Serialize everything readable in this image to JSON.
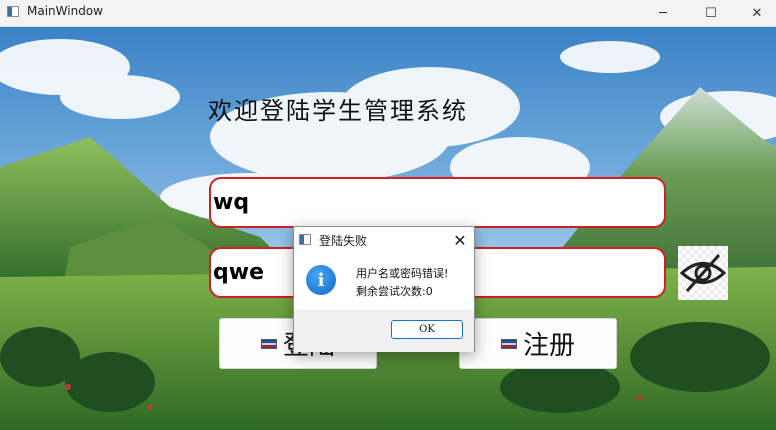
{
  "window": {
    "title": "MainWindow",
    "minimize_glyph": "─",
    "maximize_glyph": "☐",
    "close_glyph": "✕"
  },
  "main": {
    "heading": "欢迎登陆学生管理系统",
    "username_value": "wq",
    "password_value": "qwe",
    "toggle_icon": "eye-slash-icon",
    "login_label": "登陆",
    "register_label": "注册"
  },
  "dialog": {
    "title": "登陆失败",
    "close_glyph": "✕",
    "icon": "info-icon",
    "icon_glyph": "i",
    "message_line1": "用户名或密码错误!",
    "message_line2": "剩余尝试次数:0",
    "ok_label": "OK"
  },
  "colors": {
    "field_border": "#d21f1f",
    "sky_top": "#3a82c6",
    "ok_border": "#1a6fd0",
    "info_icon": "#1f7fe0"
  }
}
